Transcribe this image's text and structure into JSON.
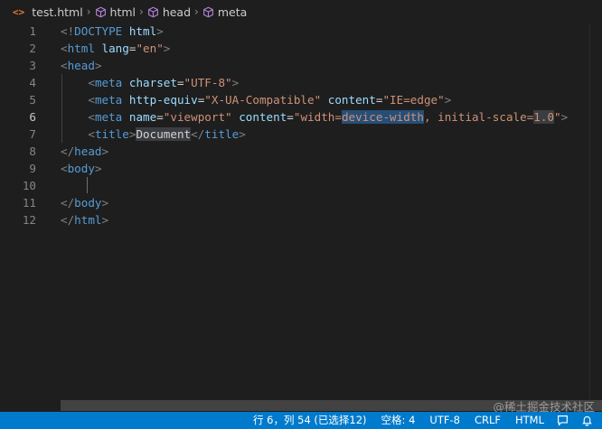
{
  "breadcrumb": {
    "items": [
      {
        "label": "test.html",
        "icon": "html-file-icon"
      },
      {
        "label": "html",
        "icon": "symbol-cube-icon"
      },
      {
        "label": "head",
        "icon": "symbol-cube-icon"
      },
      {
        "label": "meta",
        "icon": "symbol-cube-icon"
      }
    ],
    "file_icon_glyph": "<>"
  },
  "editor": {
    "line_numbers": [
      "1",
      "2",
      "3",
      "4",
      "5",
      "6",
      "7",
      "8",
      "9",
      "10",
      "11",
      "12"
    ],
    "active_line": "6",
    "lines": {
      "l1": {
        "a": "<!",
        "b": "DOCTYPE",
        "c": " html",
        "d": ">"
      },
      "l2": {
        "a": "<",
        "b": "html",
        "c": " lang",
        "d": "=",
        "e": "\"en\"",
        "f": ">"
      },
      "l3": {
        "a": "<",
        "b": "head",
        "c": ">"
      },
      "l4": {
        "a": "<",
        "b": "meta",
        "c": " charset",
        "d": "=",
        "e": "\"UTF-8\"",
        "f": ">"
      },
      "l5": {
        "a": "<",
        "b": "meta",
        "c": " http-equiv",
        "d": "=",
        "e": "\"X-UA-Compatible\"",
        "f": " content",
        "g": "=",
        "h": "\"IE=edge\"",
        "i": ">"
      },
      "l6": {
        "a": "<",
        "b": "meta",
        "c": " name",
        "d": "=",
        "e": "\"viewport\"",
        "f": " content",
        "g": "=",
        "h1": "\"width=",
        "h2": "device-width",
        "h3": ", initial-scale=",
        "h4": "1.0",
        "h5": "\"",
        "i": ">"
      },
      "l7": {
        "a": "<",
        "b": "title",
        "c": ">",
        "d": "Document",
        "e": "</",
        "f": "title",
        "g": ">"
      },
      "l8": {
        "a": "</",
        "b": "head",
        "c": ">"
      },
      "l9": {
        "a": "<",
        "b": "body",
        "c": ">"
      },
      "l11": {
        "a": "</",
        "b": "body",
        "c": ">"
      },
      "l12": {
        "a": "</",
        "b": "html",
        "c": ">"
      }
    }
  },
  "watermark": "@稀土掘金技术社区",
  "statusbar": {
    "position": "行 6，列 54 (已选择12)",
    "spaces": "空格: 4",
    "encoding": "UTF-8",
    "eol": "CRLF",
    "language": "HTML",
    "icons": [
      "feedback-icon",
      "bell-icon"
    ]
  },
  "colors": {
    "background": "#1e1e1e",
    "statusbar": "#007acc",
    "tag": "#569cd6",
    "attribute": "#9cdcfe",
    "string": "#ce9178",
    "selection": "#264f78"
  }
}
